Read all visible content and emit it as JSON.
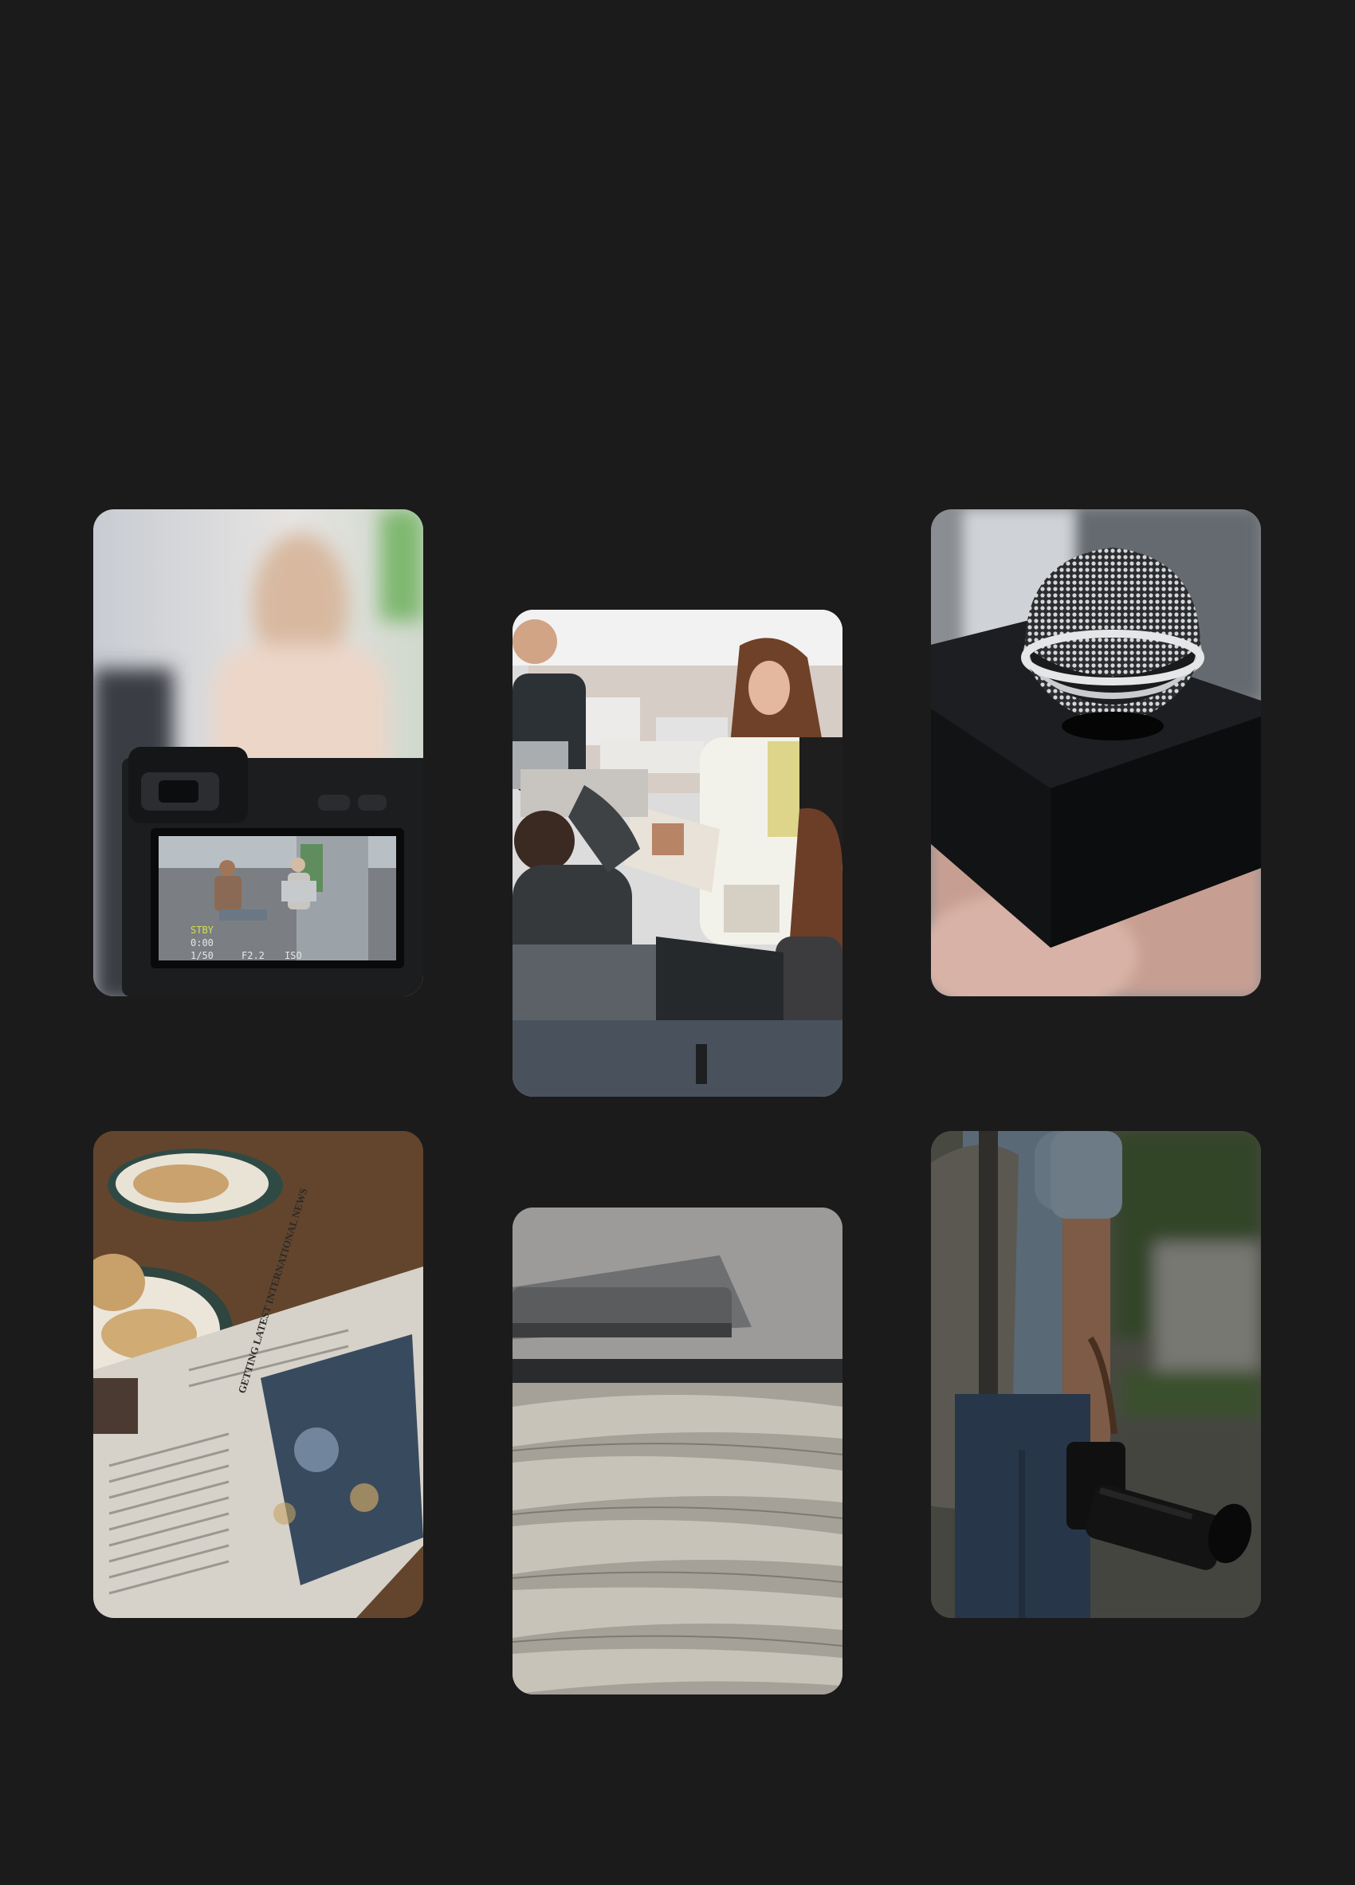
{
  "gallery": {
    "cards": [
      {
        "subject": "camera-viewfinder",
        "viewfinder": {
          "mode": "STBY",
          "time": "0:00",
          "shutter": "1/50",
          "aperture": "F2.2",
          "iso": "ISO"
        }
      },
      {
        "subject": "newsroom-team"
      },
      {
        "subject": "microphone"
      },
      {
        "subject": "newspaper-breakfast",
        "newspaper": {
          "headline": "GETTING LATEST INTERNATIONAL NEWS"
        }
      },
      {
        "subject": "newspaper-stack"
      },
      {
        "subject": "photographer-with-camera"
      }
    ]
  },
  "colors": {
    "background": "#1b1b1b"
  }
}
